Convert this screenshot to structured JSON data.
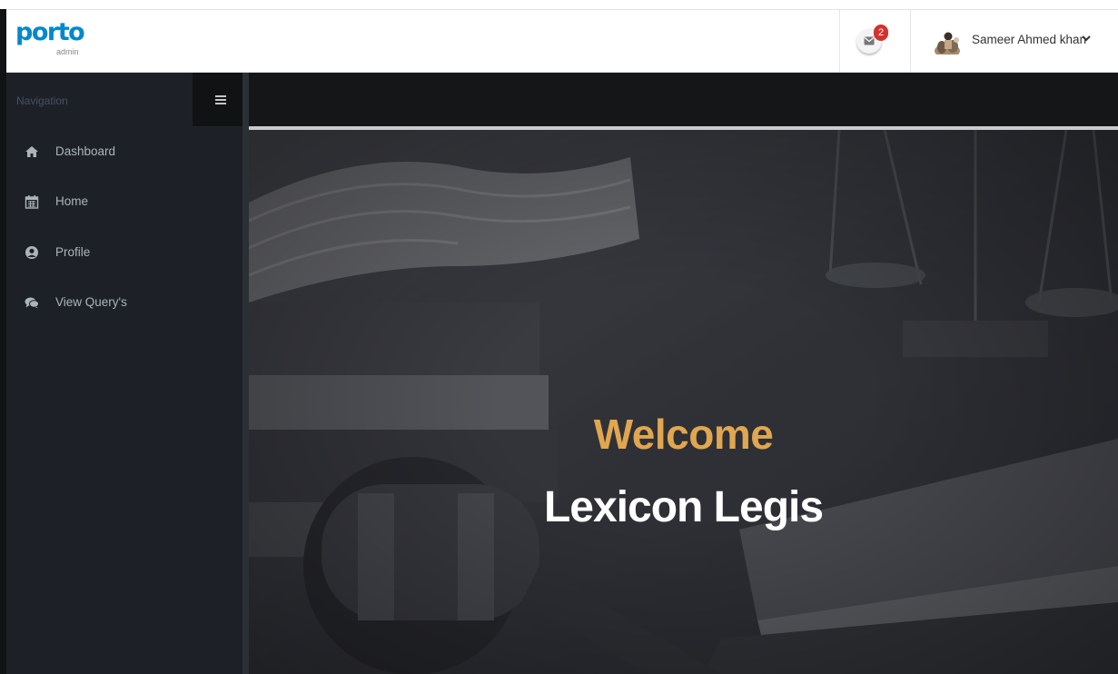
{
  "header": {
    "logo_text": "porto",
    "logo_sub": "admin",
    "notification_count": "2",
    "user_name": "Sameer Ahmed khan"
  },
  "sidebar": {
    "title": "Navigation",
    "items": [
      {
        "label": "Dashboard",
        "icon": "home-icon"
      },
      {
        "label": "Home",
        "icon": "calendar-icon"
      },
      {
        "label": "Profile",
        "icon": "user-icon"
      },
      {
        "label": "View Query's",
        "icon": "comments-icon"
      }
    ]
  },
  "hero": {
    "welcome": "Welcome",
    "brand": "Lexicon Legis"
  },
  "colors": {
    "accent": "#0088cc",
    "welcome": "#e0a650",
    "sidebar_bg": "#1d2127",
    "badge": "#d2322d"
  }
}
